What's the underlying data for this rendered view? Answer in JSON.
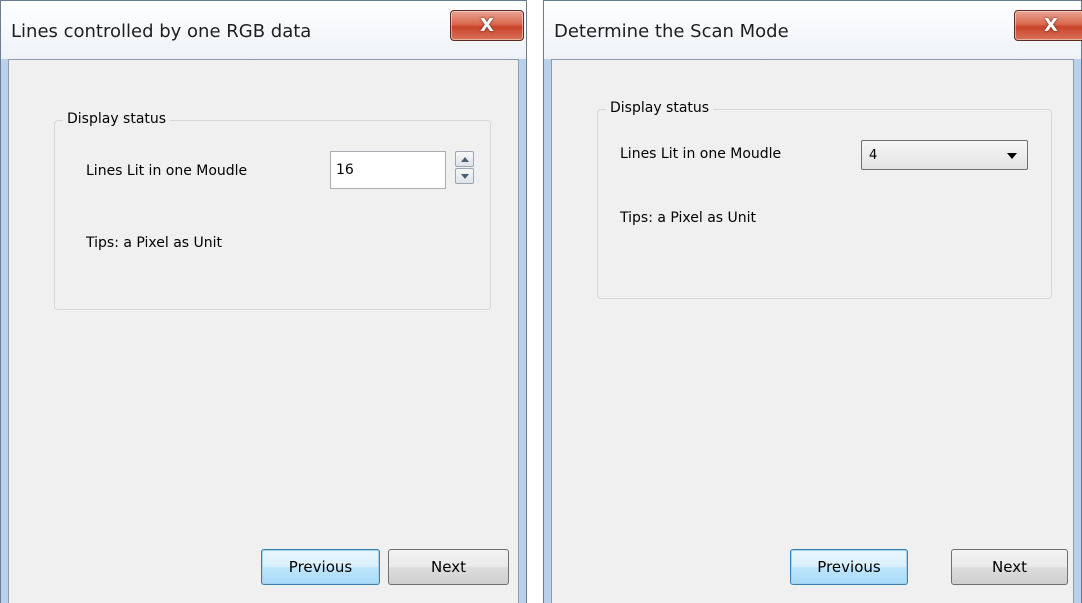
{
  "windows": [
    {
      "title": "Lines controlled by one RGB data",
      "close_label": "X",
      "group_title": "Display status",
      "field_label": "Lines Lit in one Moudle",
      "field_value": "16",
      "tips": "Tips: a Pixel as Unit",
      "previous_label": "Previous",
      "next_label": "Next"
    },
    {
      "title": "Determine the Scan Mode",
      "close_label": "X",
      "group_title": "Display status",
      "field_label": "Lines Lit in one Moudle",
      "field_value": "4",
      "tips": "Tips: a Pixel as Unit",
      "previous_label": "Previous",
      "next_label": "Next"
    }
  ],
  "icons": {
    "close": "close-icon",
    "spin_up": "spin-up-icon",
    "spin_down": "spin-down-icon",
    "dropdown": "dropdown-arrow-icon"
  },
  "colors": {
    "window_frame": "#b9d1ea",
    "client_background": "#f0f0f0",
    "close_button_red": "#c8432a",
    "default_button_blue": "#a7d9f5"
  }
}
